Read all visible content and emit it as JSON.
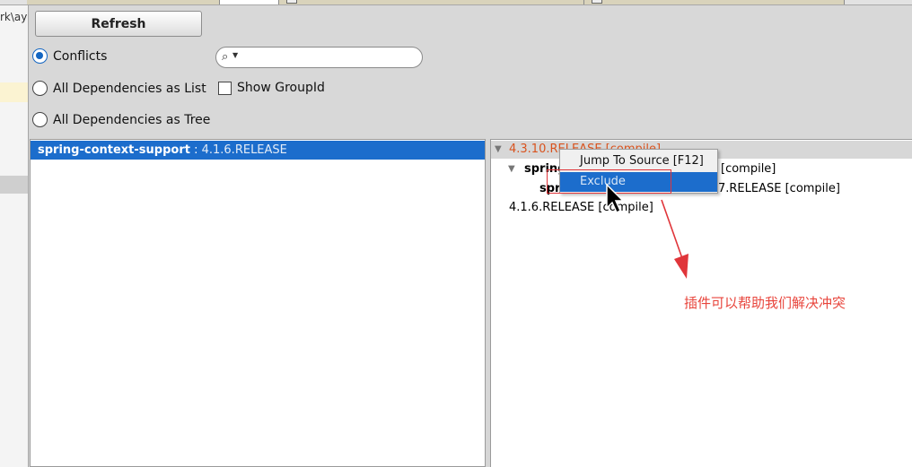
{
  "tabs": [
    {
      "label": "",
      "active": false
    },
    {
      "label": "",
      "active": true
    },
    {
      "label": "",
      "active": false
    },
    {
      "label": "",
      "active": false
    }
  ],
  "left_sliver": {
    "text": "rk\\ay"
  },
  "toolbar": {
    "refresh_label": "Refresh"
  },
  "view_mode": {
    "options": [
      {
        "label": "Conflicts",
        "checked": true
      },
      {
        "label": "All Dependencies as List",
        "checked": false
      },
      {
        "label": "All Dependencies as Tree",
        "checked": false
      }
    ],
    "show_group_id": {
      "label": "Show GroupId",
      "checked": false
    }
  },
  "search": {
    "value": "",
    "placeholder": ""
  },
  "conflict_list": {
    "selected": {
      "artifact": "spring-context-support",
      "separator": " : ",
      "version": "4.1.6.RELEASE"
    }
  },
  "tree": {
    "root": {
      "text": "4.3.10.RELEASE [compile]",
      "color": "#d9531e"
    },
    "child1": {
      "artifact": "spring",
      "suffix": "[compile]"
    },
    "child2": {
      "artifact": "spri",
      "suffix": "7.RELEASE [compile]"
    },
    "child3": {
      "text": "4.1.6.RELEASE [compile]"
    }
  },
  "context_menu": {
    "items": [
      {
        "label": "Jump To Source [F12]",
        "highlighted": false
      },
      {
        "label": "Exclude",
        "highlighted": true
      }
    ]
  },
  "annotation": {
    "text": "插件可以帮助我们解决冲突",
    "color": "#e8453c"
  },
  "colors": {
    "selection": "#1c6dcc",
    "radio_accent": "#1466c2",
    "annotation_red": "#e0353a"
  }
}
